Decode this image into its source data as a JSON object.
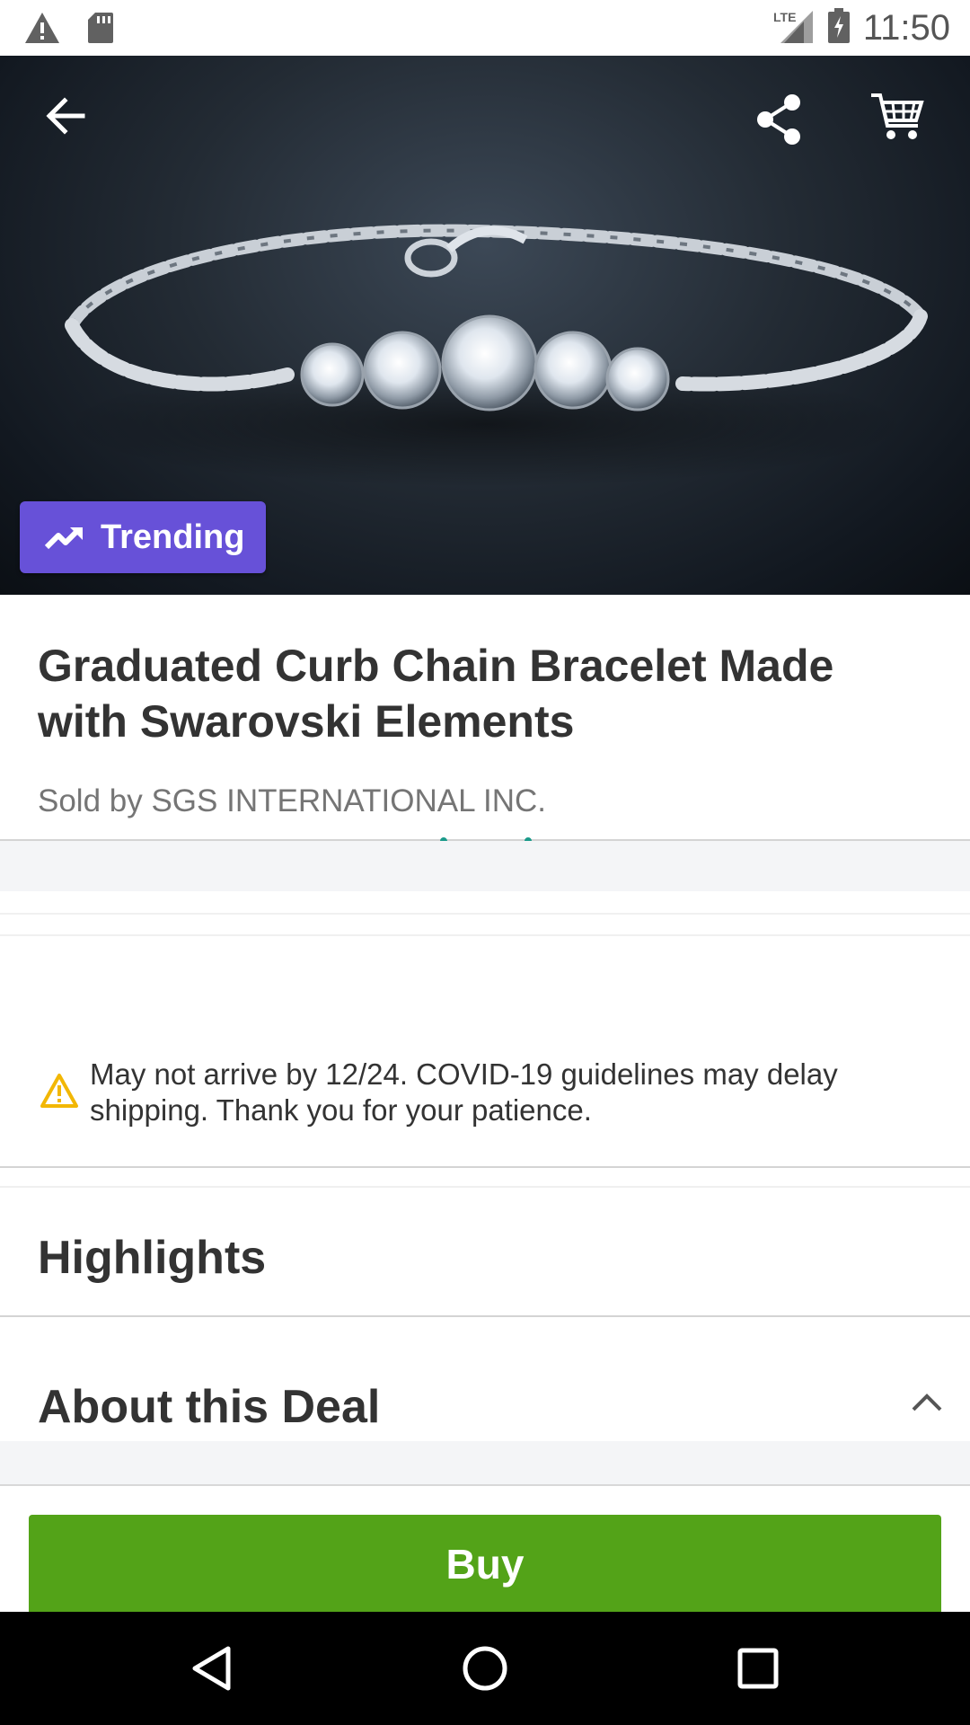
{
  "status_bar": {
    "network": "LTE",
    "time": "11:50",
    "icons": [
      "alert-icon",
      "sd-card-icon",
      "signal-icon",
      "battery-charging-icon"
    ]
  },
  "toolbar": {
    "icons": [
      "back-arrow-icon",
      "share-icon",
      "cart-icon"
    ]
  },
  "hero": {
    "badge_label": "Trending",
    "badge_icon": "trending-up-icon",
    "badge_color": "#6751d8"
  },
  "product": {
    "title": "Graduated Curb Chain Bracelet Made with Swarovski Elements",
    "seller": "Sold by SGS INTERNATIONAL INC."
  },
  "notice": {
    "icon": "warning-icon",
    "text": "May not arrive by 12/24. COVID-19 guidelines may delay shipping. Thank you for your patience."
  },
  "sections": {
    "highlights": "Highlights",
    "about": "About this Deal"
  },
  "buy_bar": {
    "label": "Buy",
    "color": "#53a318"
  },
  "nav_bar": {
    "icons": [
      "back-triangle-icon",
      "home-circle-icon",
      "recents-square-icon"
    ]
  }
}
